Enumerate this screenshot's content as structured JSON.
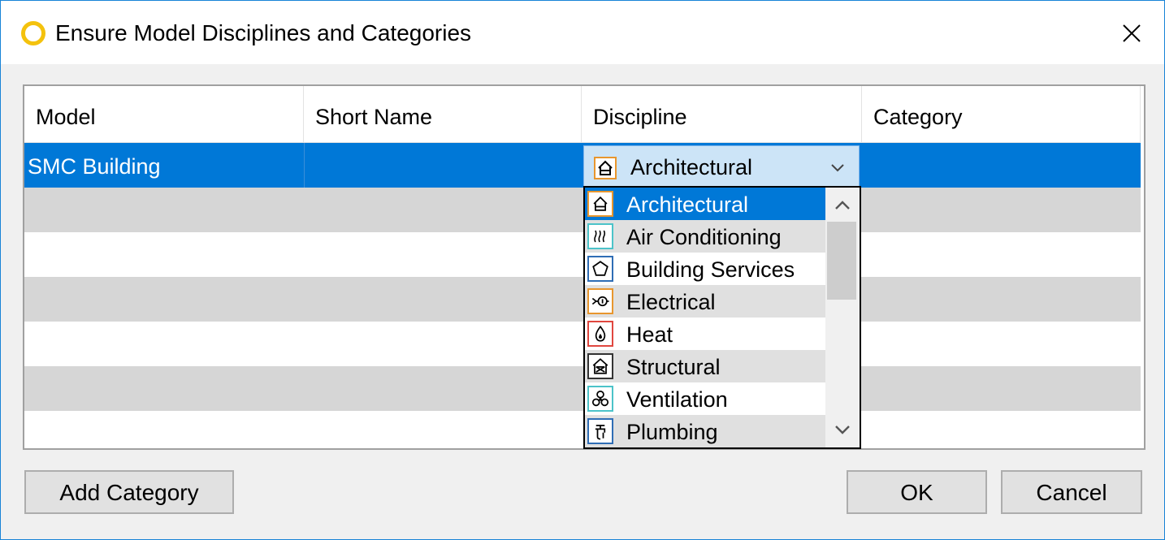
{
  "window": {
    "title": "Ensure Model Disciplines and Categories",
    "accent": "#0078d7"
  },
  "grid": {
    "columns": [
      "Model",
      "Short Name",
      "Discipline",
      "Category"
    ],
    "rows": [
      {
        "model": "SMC Building",
        "short_name": "",
        "discipline": "Architectural",
        "category": ""
      }
    ]
  },
  "dropdown": {
    "options": [
      {
        "label": "Architectural",
        "icon": "architectural-icon",
        "color": "#e8962e"
      },
      {
        "label": "Air Conditioning",
        "icon": "air-conditioning-icon",
        "color": "#4cc3c9"
      },
      {
        "label": "Building Services",
        "icon": "building-services-icon",
        "color": "#2f6db5"
      },
      {
        "label": "Electrical",
        "icon": "electrical-icon",
        "color": "#e8962e"
      },
      {
        "label": "Heat",
        "icon": "heat-icon",
        "color": "#e0473f"
      },
      {
        "label": "Structural",
        "icon": "structural-icon",
        "color": "#333333"
      },
      {
        "label": "Ventilation",
        "icon": "ventilation-icon",
        "color": "#4cc3c9"
      },
      {
        "label": "Plumbing",
        "icon": "plumbing-icon",
        "color": "#2f6db5"
      }
    ],
    "selected": "Architectural"
  },
  "buttons": {
    "add_category": "Add Category",
    "ok": "OK",
    "cancel": "Cancel"
  }
}
